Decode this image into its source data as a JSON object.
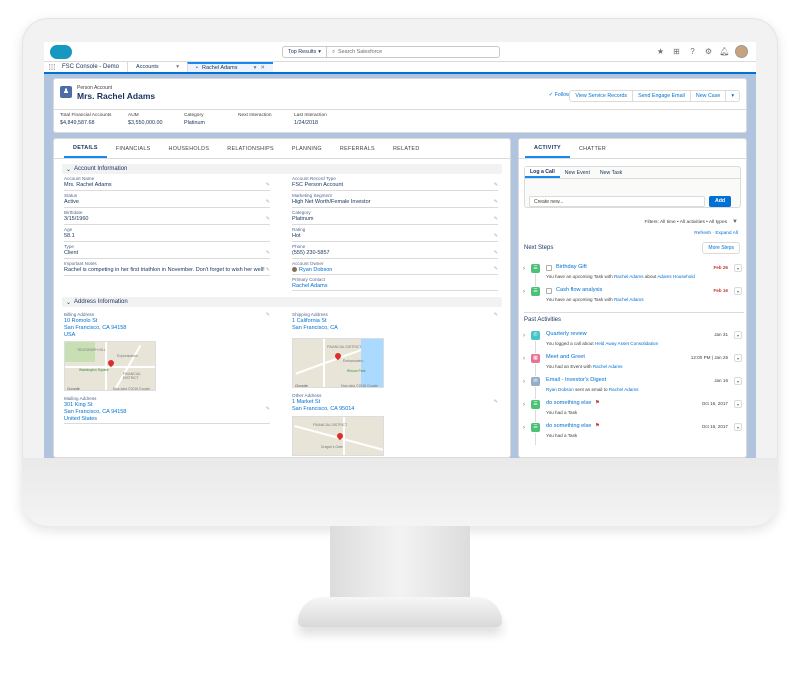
{
  "topbar": {
    "search_scope": "Top Results",
    "search_placeholder": "Search Salesforce"
  },
  "nav": {
    "app_name": "FSC Console - Demo",
    "tabs": [
      {
        "label": "Accounts"
      },
      {
        "label": "Rachel Adams"
      }
    ]
  },
  "record": {
    "type": "Person Account",
    "name": "Mrs. Rachel Adams",
    "actions": [
      "Following",
      "View Service Records",
      "Send Engage Email",
      "New Case"
    ],
    "highlights": [
      {
        "label": "Total Financial Accounts",
        "value": "$4,849,587.68"
      },
      {
        "label": "AUM",
        "value": "$3,550,000.00"
      },
      {
        "label": "Category",
        "value": "Platinum"
      },
      {
        "label": "Next Interaction",
        "value": ""
      },
      {
        "label": "Last Interaction",
        "value": "1/24/2018"
      }
    ]
  },
  "detail_tabs": [
    "DETAILS",
    "FINANCIALS",
    "HOUSEHOLDS",
    "RELATIONSHIPS",
    "PLANNING",
    "REFERRALS",
    "RELATED"
  ],
  "account_info": {
    "title": "Account Information",
    "left": [
      {
        "label": "Account Name",
        "value": "Mrs. Rachel Adams"
      },
      {
        "label": "Status",
        "value": "Active"
      },
      {
        "label": "Birthdate",
        "value": "3/15/1960"
      },
      {
        "label": "Age",
        "value": "58.1"
      },
      {
        "label": "Type",
        "value": "Client"
      },
      {
        "label": "Important Notes",
        "value": "Rachel is competing in her first triathlon in November. Don't forget to wish her well!"
      }
    ],
    "right": [
      {
        "label": "Account Record Type",
        "value": "FSC Person Account"
      },
      {
        "label": "Marketing Segment",
        "value": "High Net Worth/Female Investor"
      },
      {
        "label": "Category",
        "value": "Platinum"
      },
      {
        "label": "Rating",
        "value": "Hot"
      },
      {
        "label": "Phone",
        "value": "(555) 230-5857"
      },
      {
        "label": "Account Owner",
        "value": "Ryan Dobson"
      },
      {
        "label": "Primary Contact",
        "value": "Rachel Adams"
      }
    ]
  },
  "address_info": {
    "title": "Address Information",
    "billing": {
      "label": "Billing Address",
      "lines": [
        "10 Romolo St",
        "San Francisco, CA 94158",
        "USA"
      ]
    },
    "shipping": {
      "label": "Shipping Address",
      "lines": [
        "1 California St",
        "San Francisco, CA"
      ]
    },
    "mailing": {
      "label": "Mailing Address",
      "lines": [
        "301 King St",
        "San Francisco, CA 94158",
        "United States"
      ]
    },
    "other": {
      "label": "Other Address",
      "lines": [
        "1 Market St",
        "San Francisco, CA 95014"
      ]
    },
    "map_labels": [
      "TELEGRAPH HILL",
      "Exploratorium",
      "Washington Square",
      "FINANCIAL DISTRICT",
      "Google",
      "Map data ©2018 Google"
    ],
    "map2_labels": [
      "FINANCIAL DISTRICT",
      "Embarcadero",
      "Rincon Park",
      "Google",
      "Map data ©2018 Google"
    ],
    "map3_labels": [
      "FINANCIAL DISTRICT",
      "Dragon's Gate",
      "Google",
      "Map data ©2018 Google"
    ]
  },
  "activity": {
    "tabs": [
      "ACTIVITY",
      "CHATTER"
    ],
    "composer_tabs": [
      "Log a Call",
      "New Event",
      "New Task"
    ],
    "composer_placeholder": "Create new...",
    "add_label": "Add",
    "filters": "Filters: All time • All activities • All types",
    "refresh": "Refresh · Expand All",
    "next_steps_title": "Next Steps",
    "more_steps": "More Steps",
    "past_title": "Past Activities",
    "next_steps": [
      {
        "title": "Birthday Gift",
        "pre": "You have an upcoming Task with ",
        "who": "Rachel Adams",
        "mid": " about ",
        "what": "Adams Household",
        "date": "Feb 26"
      },
      {
        "title": "Cash flow analysis",
        "pre": "You have an upcoming Task with ",
        "who": "Rachel Adams",
        "mid": "",
        "what": "",
        "date": "Feb 16"
      }
    ],
    "past": [
      {
        "title": "Quarterly review",
        "pre": "You logged a call about ",
        "who": "Held Away Asset Consolidation",
        "mid": "",
        "what": "",
        "date": "Jan 31",
        "color": "#48c3cc",
        "glyph": "✆"
      },
      {
        "title": "Meet and Greet",
        "pre": "You had an Event with ",
        "who": "Rachel Adams",
        "mid": "",
        "what": "",
        "date": "12:00 PM | Jan 25",
        "color": "#eb7092",
        "glyph": "▦"
      },
      {
        "title": "Email - Investor's Digest",
        "pre": "",
        "who": "Ryan Dobson",
        "mid": " sent an email to ",
        "what": "Rachel Adams",
        "date": "Jan 16",
        "color": "#95aec5",
        "glyph": "✉"
      },
      {
        "title": "do something else",
        "pre": "You had a Task",
        "who": "",
        "mid": "",
        "what": "",
        "date": "Oct 16, 2017",
        "color": "#4bc076",
        "glyph": "✓"
      },
      {
        "title": "do something else",
        "pre": "You had a Task",
        "who": "",
        "mid": "",
        "what": "",
        "date": "Oct 16, 2017",
        "color": "#4bc076",
        "glyph": "✓"
      }
    ]
  },
  "colors": {
    "brand": "#0070d2",
    "header_bg": "#b0c4df",
    "task_green": "#4bc076",
    "overdue_red": "#c23934"
  }
}
